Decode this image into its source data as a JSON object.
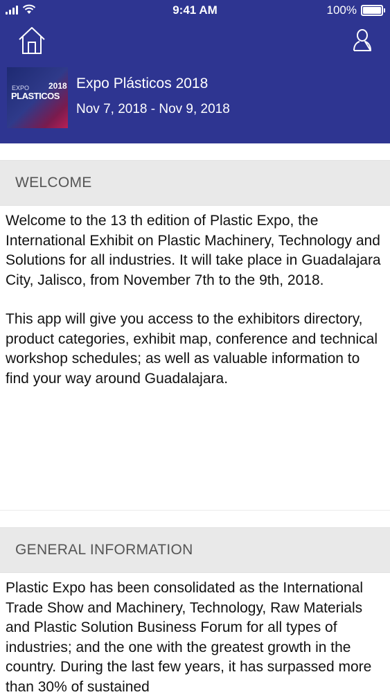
{
  "status_bar": {
    "time": "9:41 AM",
    "battery": "100%"
  },
  "nav": {
    "home_icon": "home-icon",
    "profile_icon": "user-icon"
  },
  "event": {
    "title": "Expo Plásticos 2018",
    "dates": "Nov 7, 2018 - Nov 9, 2018",
    "logo": {
      "expo": "EXPO",
      "year": "2018",
      "name": "PLASTICOS"
    }
  },
  "welcome": {
    "heading": "WELCOME",
    "paragraph1": "Welcome to the 13 th edition of Plastic Expo, the International Exhibit on Plastic Machinery, Technology and Solutions for all industries. It will take place in Guadalajara City, Jalisco, from November 7th to the 9th, 2018.",
    "paragraph2": "This app will give you access to the exhibitors directory, product categories, exhibit map, conference and technical workshop schedules; as well as valuable information to find your way around Guadalajara."
  },
  "general_information": {
    "heading": "GENERAL INFORMATION",
    "paragraph1": "Plastic Expo has been consolidated as the International Trade Show and Machinery, Technology, Raw Materials and Plastic Solution Business Forum for all types of industries; and the one with the greatest growth in the country. During the last few years, it has surpassed more than 30% of sustained"
  },
  "colors": {
    "header_bg": "#2e3591",
    "section_header_bg": "#e9e9e9"
  }
}
